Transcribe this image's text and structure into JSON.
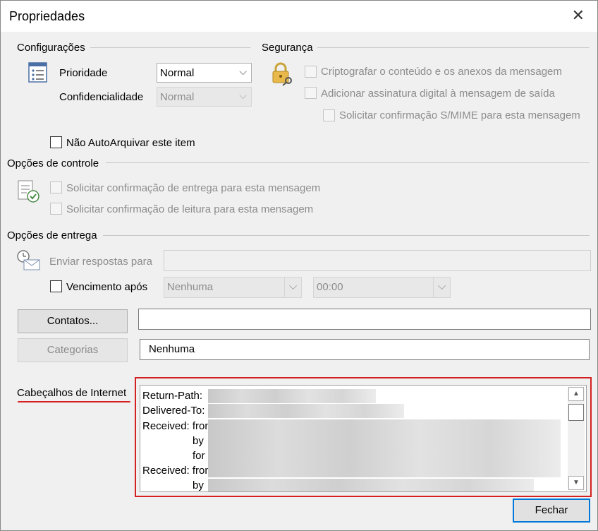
{
  "window": {
    "title": "Propriedades",
    "close_glyph": "✕"
  },
  "config": {
    "section_title": "Configurações",
    "priority_label": "Prioridade",
    "priority_value": "Normal",
    "sensitivity_label": "Confidencialidade",
    "sensitivity_value": "Normal",
    "no_autoarchive_label": "Não AutoArquivar este item"
  },
  "security": {
    "section_title": "Segurança",
    "encrypt_label": "Criptografar o conteúdo e os anexos da mensagem",
    "signature_label": "Adicionar assinatura digital à mensagem de saída",
    "smime_label": "Solicitar confirmação S/MIME para esta mensagem"
  },
  "tracking": {
    "section_title": "Opções de controle",
    "delivery_receipt_label": "Solicitar confirmação de entrega para esta mensagem",
    "read_receipt_label": "Solicitar confirmação de leitura para esta mensagem"
  },
  "delivery": {
    "section_title": "Opções de entrega",
    "reply_to_label": "Enviar respostas para",
    "reply_to_value": "",
    "expires_label": "Vencimento após",
    "expires_date": "Nenhuma",
    "expires_time": "00:00"
  },
  "contacts": {
    "button_label": "Contatos...",
    "value": ""
  },
  "categories": {
    "button_label": "Categorias",
    "value": "Nenhuma"
  },
  "headers": {
    "label": "Cabeçalhos de Internet",
    "lines": [
      "Return-Path:",
      "Delivered-To:",
      "Received: from",
      "by",
      "for",
      "Received: from",
      "by"
    ]
  },
  "footer": {
    "close_label": "Fechar"
  },
  "colors": {
    "highlight_border": "#d42020",
    "primary_border": "#0078d7"
  }
}
